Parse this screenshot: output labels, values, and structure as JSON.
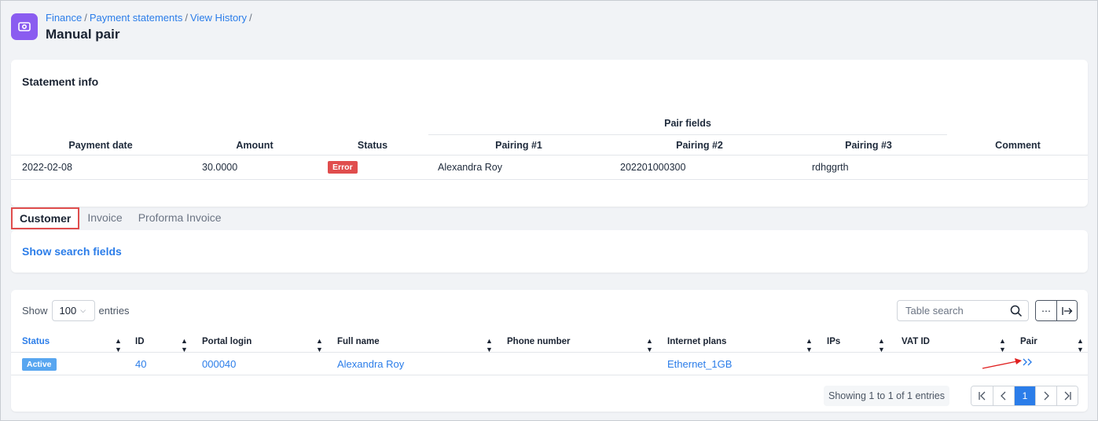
{
  "breadcrumb": {
    "items": [
      "Finance",
      "Payment statements",
      "View History"
    ],
    "separator": "/"
  },
  "page_title": "Manual pair",
  "statement": {
    "title": "Statement info",
    "group_header": "Pair fields",
    "columns": [
      "Payment date",
      "Amount",
      "Status",
      "Pairing #1",
      "Pairing #2",
      "Pairing #3",
      "Comment"
    ],
    "row": {
      "payment_date": "2022-02-08",
      "amount": "30.0000",
      "status": "Error",
      "pairing1": "Alexandra Roy",
      "pairing2": "202201000300",
      "pairing3": "rdhggrth",
      "comment": ""
    }
  },
  "tabs": [
    {
      "label": "Customer",
      "active": true
    },
    {
      "label": "Invoice",
      "active": false
    },
    {
      "label": "Proforma Invoice",
      "active": false
    }
  ],
  "search": {
    "show_fields_label": "Show search fields"
  },
  "results": {
    "show_label": "Show",
    "entries_value": "100",
    "entries_label": "entries",
    "search_placeholder": "Table search",
    "columns": [
      "Status",
      "ID",
      "Portal login",
      "Full name",
      "Phone number",
      "Internet plans",
      "IPs",
      "VAT ID",
      "Pair"
    ],
    "row": {
      "status": "Active",
      "id": "40",
      "portal_login": "000040",
      "full_name": "Alexandra Roy",
      "phone": "",
      "internet_plans": "Ethernet_1GB",
      "ips": "",
      "vat_id": "",
      "pair_icon": "double-chevron-right-icon"
    },
    "showing_text": "Showing 1 to 1 of 1 entries",
    "current_page": "1"
  },
  "colors": {
    "accent": "#2b7de9",
    "app_icon": "#8a5cf0",
    "error": "#e04d4d",
    "active": "#58a6f0"
  }
}
